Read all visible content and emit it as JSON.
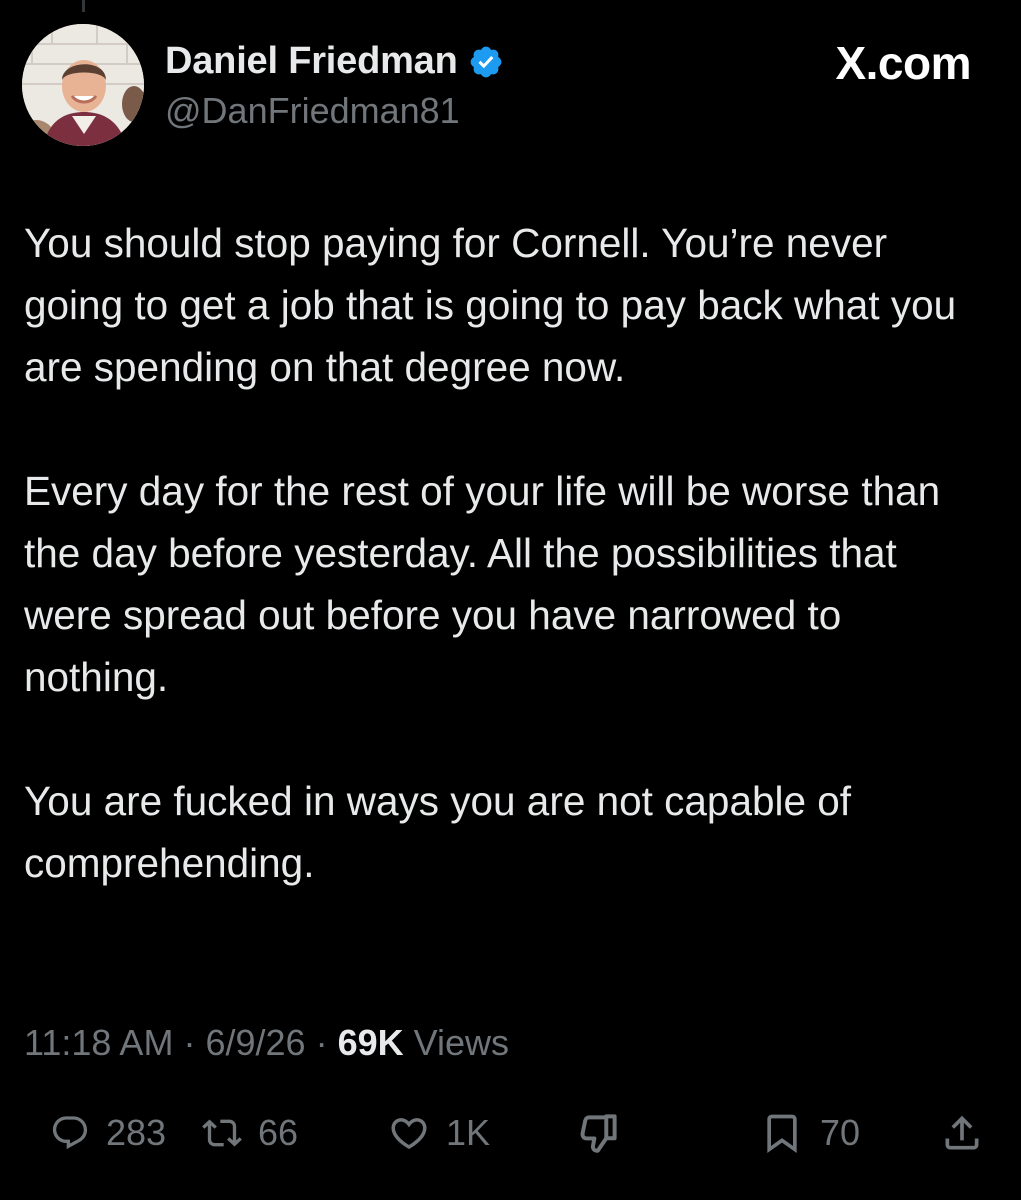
{
  "author": {
    "display_name": "Daniel Friedman",
    "handle": "@DanFriedman81",
    "verified": true
  },
  "site_mark": "X.com",
  "tweet": {
    "paragraphs": [
      "You should stop paying for Cornell. You’re never going to get a job that is going to pay back what you are spending on that degree now.",
      "Every day for the rest of your life will be worse than the day before yesterday. All the possibilities that were spread out before you have narrowed to nothing.",
      "You are fucked in ways you are not capable of comprehending."
    ]
  },
  "meta": {
    "time": "11:18 AM",
    "separator": "·",
    "date": "6/9/26",
    "views_count": "69K",
    "views_label": "Views"
  },
  "actions": {
    "replies": "283",
    "reposts": "66",
    "likes": "1K",
    "bookmarks": "70"
  },
  "icons": {
    "reply": "speech-bubble-icon",
    "repost": "repost-arrows-icon",
    "like": "heart-icon",
    "dislike": "thumbs-down-icon",
    "bookmark": "bookmark-icon",
    "share": "share-upload-icon",
    "verified": "verified-badge-icon"
  },
  "colors": {
    "background": "#000000",
    "text": "#e7e9ea",
    "secondary_text": "#71767b",
    "verified_blue": "#1d9bf0"
  }
}
